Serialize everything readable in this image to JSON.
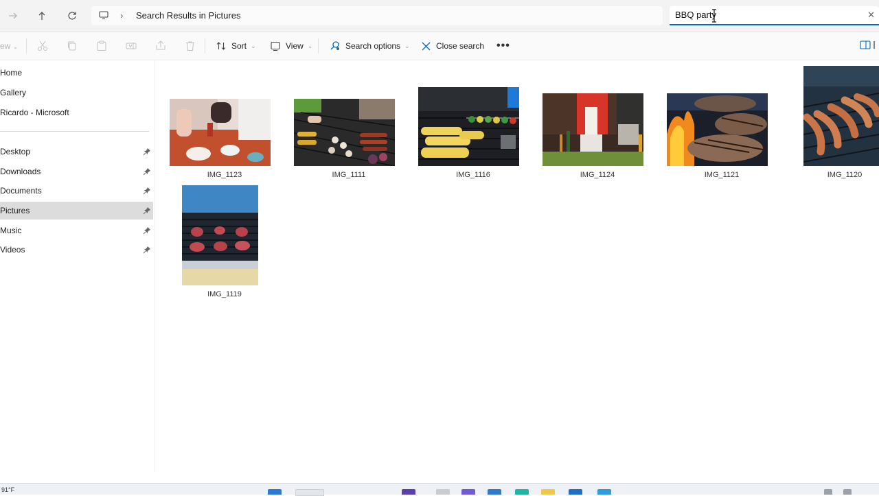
{
  "address_bar": {
    "back_icon": "arrow-left-icon",
    "forward_icon": "arrow-right-icon",
    "up_icon": "arrow-up-icon",
    "refresh_icon": "refresh-icon",
    "location_icon": "monitor-icon",
    "breadcrumb_text": "Search Results in Pictures",
    "search_value": "BBQ party",
    "clear_icon": "close-icon"
  },
  "toolbar": {
    "new_label": "ew",
    "sort_label": "Sort",
    "view_label": "View",
    "search_options_label": "Search options",
    "close_search_label": "Close search",
    "more_label": "•••"
  },
  "sidebar": {
    "top_items": [
      {
        "label": "Home"
      },
      {
        "label": "Gallery"
      },
      {
        "label": "Ricardo - Microsoft"
      }
    ],
    "pinned_items": [
      {
        "label": "Desktop"
      },
      {
        "label": "Downloads"
      },
      {
        "label": "Documents"
      },
      {
        "label": "Pictures",
        "selected": true
      },
      {
        "label": "Music"
      },
      {
        "label": "Videos"
      }
    ]
  },
  "files": [
    {
      "name": "IMG_1123"
    },
    {
      "name": "IMG_1111"
    },
    {
      "name": "IMG_1116"
    },
    {
      "name": "IMG_1124"
    },
    {
      "name": "IMG_1121"
    },
    {
      "name": "IMG_1120"
    },
    {
      "name": "IMG_1119"
    }
  ],
  "taskbar": {
    "temperature": "91°F"
  },
  "colors": {
    "accent": "#0067c0",
    "selected_bg": "#dcdcdc"
  }
}
